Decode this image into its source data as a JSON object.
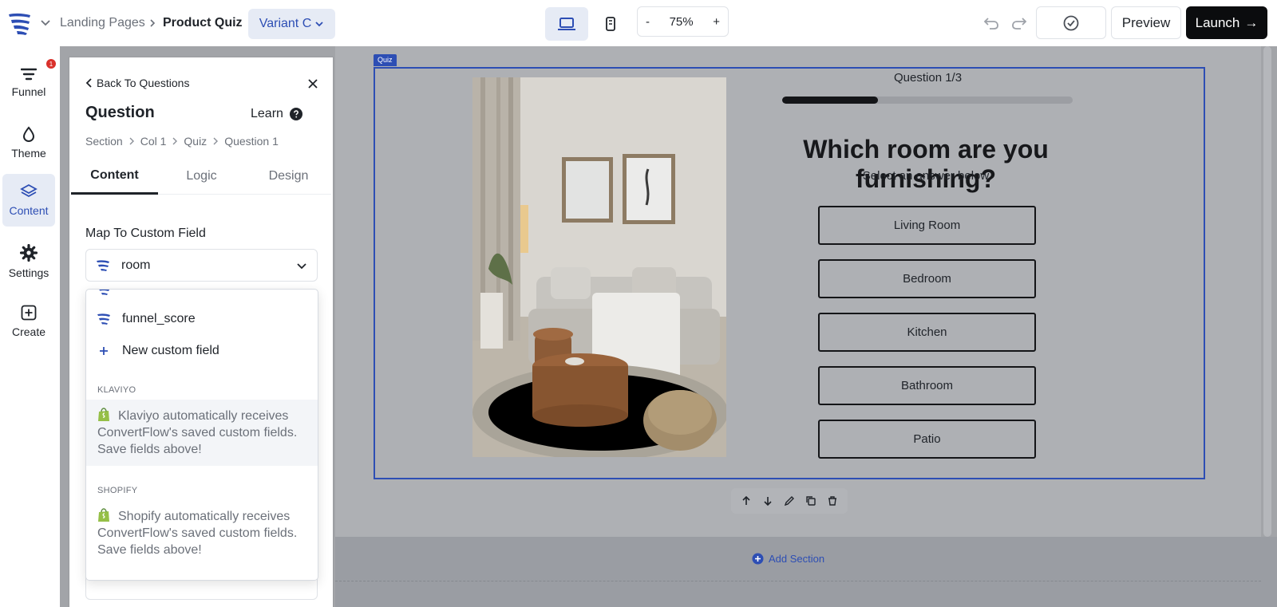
{
  "topbar": {
    "breadcrumb": [
      "Landing Pages",
      "Product Quiz"
    ],
    "variant": "Variant C",
    "zoom": {
      "minus": "-",
      "value": "75%",
      "plus": "+"
    },
    "preview": "Preview",
    "launch": "Launch",
    "launch_arrow": "→"
  },
  "rail": {
    "items": [
      {
        "label": "Funnel",
        "icon": "funnel-icon",
        "badge": "1"
      },
      {
        "label": "Theme",
        "icon": "drop-icon"
      },
      {
        "label": "Content",
        "icon": "layers-icon"
      },
      {
        "label": "Settings",
        "icon": "gear-icon"
      },
      {
        "label": "Create",
        "icon": "plus-square-icon"
      }
    ]
  },
  "panel": {
    "back": "Back To Questions",
    "title": "Question",
    "learn": "Learn",
    "crumbs": [
      "Section",
      "Col 1",
      "Quiz",
      "Question 1"
    ],
    "tabs": [
      "Content",
      "Logic",
      "Design"
    ],
    "map_label": "Map To Custom Field",
    "map_value": "room"
  },
  "dropdown": {
    "options": [
      {
        "label": "funnel_score",
        "icon": "convertflow-icon"
      },
      {
        "label": "New custom field",
        "icon": "plus-icon"
      }
    ],
    "sections": [
      {
        "heading": "KLAVIYO",
        "note": "Klaviyo automatically receives ConvertFlow's saved custom fields. Save fields above!"
      },
      {
        "heading": "SHOPIFY",
        "note": "Shopify automatically receives ConvertFlow's saved custom fields. Save fields above!"
      }
    ]
  },
  "quiz": {
    "tag": "Quiz",
    "counter": "Question 1/3",
    "progress": 0.33,
    "title": "Which room are you furnishing?",
    "subtitle": "Select an answer below",
    "answers": [
      "Living Room",
      "Bedroom",
      "Kitchen",
      "Bathroom",
      "Patio"
    ],
    "add_section": "Add Section"
  },
  "colors": {
    "accent": "#2d4eb4",
    "badge": "#d9312b",
    "launch_bg": "#0b0c0e"
  }
}
